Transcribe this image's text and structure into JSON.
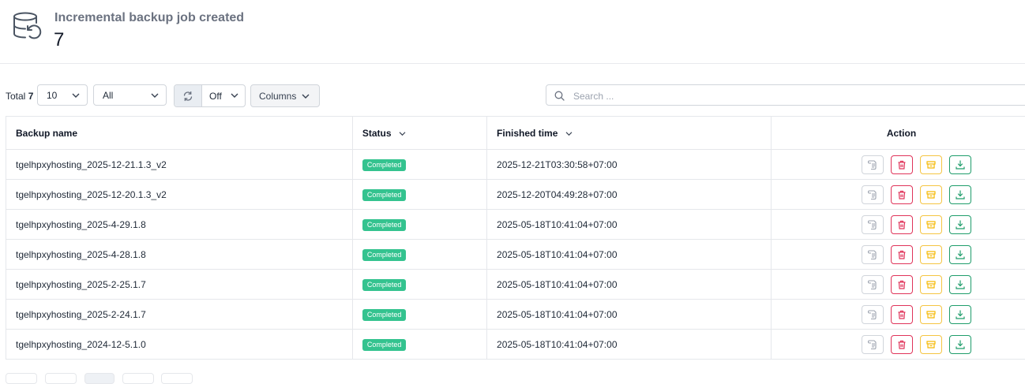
{
  "summary": {
    "title": "Incremental backup job created",
    "count": "7",
    "icon": "database-restore-icon"
  },
  "toolbar": {
    "total_label": "Total",
    "total_value": "7",
    "page_size": "10",
    "filter": "All",
    "refresh_interval": "Off",
    "columns_label": "Columns",
    "search_placeholder": "Search ..."
  },
  "table": {
    "headers": {
      "name": "Backup name",
      "status": "Status",
      "finished": "Finished time",
      "action": "Action"
    },
    "rows": [
      {
        "name": "tgelhpxyhosting_2025-12-21.1.3_v2",
        "status": "Completed",
        "finished": "2025-12-21T03:30:58+07:00"
      },
      {
        "name": "tgelhpxyhosting_2025-12-20.1.3_v2",
        "status": "Completed",
        "finished": "2025-12-20T04:49:28+07:00"
      },
      {
        "name": "tgelhpxyhosting_2025-4-29.1.8",
        "status": "Completed",
        "finished": "2025-05-18T10:41:04+07:00"
      },
      {
        "name": "tgelhpxyhosting_2025-4-28.1.8",
        "status": "Completed",
        "finished": "2025-05-18T10:41:04+07:00"
      },
      {
        "name": "tgelhpxyhosting_2025-2-25.1.7",
        "status": "Completed",
        "finished": "2025-05-18T10:41:04+07:00"
      },
      {
        "name": "tgelhpxyhosting_2025-2-24.1.7",
        "status": "Completed",
        "finished": "2025-05-18T10:41:04+07:00"
      },
      {
        "name": "tgelhpxyhosting_2024-12-5.1.0",
        "status": "Completed",
        "finished": "2025-05-18T10:41:04+07:00"
      }
    ]
  },
  "colors": {
    "completed": "#34c38f",
    "delete": "#e0345a",
    "archive": "#f5c542",
    "download": "#1f9d6b"
  }
}
